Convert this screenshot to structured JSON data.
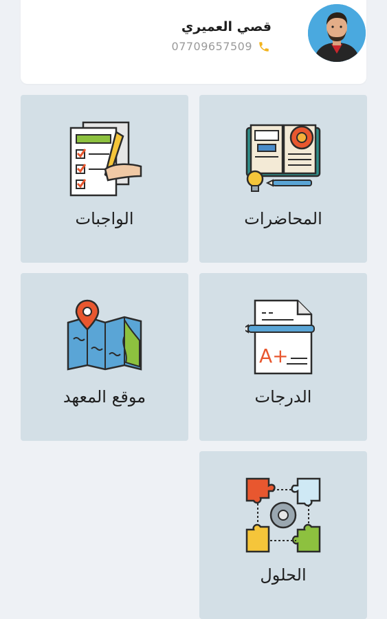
{
  "profile": {
    "name": "قصي العميري",
    "phone": "07709657509",
    "avatar_icon": "user-avatar",
    "phone_icon": "phone-icon"
  },
  "menu": {
    "tiles": [
      {
        "label": "المحاضرات",
        "icon": "lectures-book-gear-icon"
      },
      {
        "label": "الواجبات",
        "icon": "homework-checklist-icon"
      },
      {
        "label": "الدرجات",
        "icon": "grades-paper-icon"
      },
      {
        "label": "موقع المعهد",
        "icon": "map-location-icon"
      },
      {
        "label": "الحلول",
        "icon": "puzzle-solutions-icon"
      }
    ]
  },
  "colors": {
    "background": "#eef1f5",
    "tile": "#d3dfe6",
    "card": "#ffffff",
    "phone_accent": "#f2b31d"
  }
}
